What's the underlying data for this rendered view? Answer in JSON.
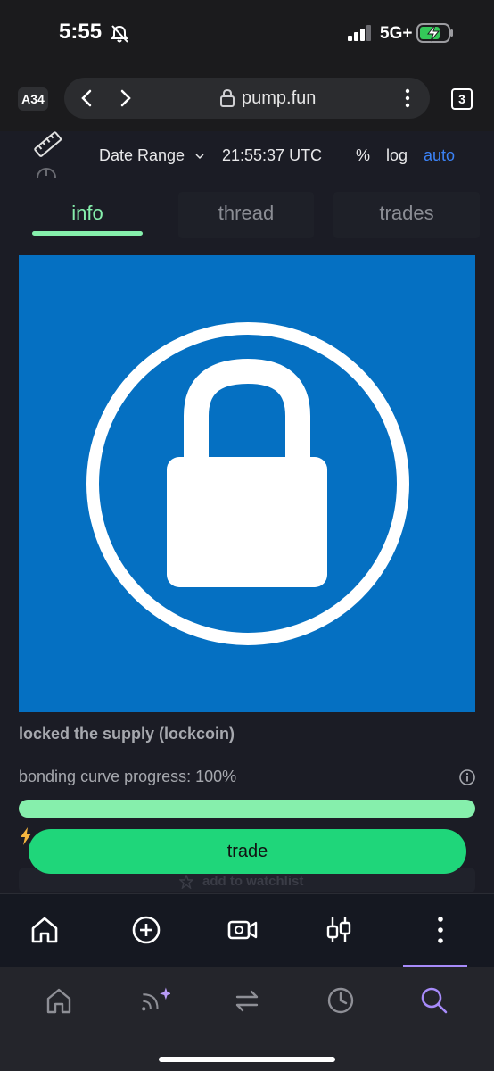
{
  "status_bar": {
    "time": "5:55",
    "network": "5G+"
  },
  "browser": {
    "profile_badge": "A34",
    "url": "pump.fun",
    "tab_count": "3"
  },
  "chart_toolbar": {
    "date_range": "Date Range",
    "utc_time": "21:55:37 UTC",
    "percent": "%",
    "log": "log",
    "auto": "auto"
  },
  "tabs": [
    {
      "label": "info",
      "active": true
    },
    {
      "label": "thread",
      "active": false
    },
    {
      "label": "trades",
      "active": false
    }
  ],
  "coin": {
    "name": "locked the supply (lockcoin)",
    "image_icon": "padlock-in-circle",
    "image_background": "#0570c2"
  },
  "bonding_curve": {
    "label": "bonding curve progress: 100%",
    "progress": 1.0
  },
  "watchlist": {
    "label": "add to watchlist"
  },
  "trade_button": {
    "label": "trade"
  },
  "app_nav": [
    {
      "icon": "home-icon"
    },
    {
      "icon": "plus-circle-icon"
    },
    {
      "icon": "video-icon"
    },
    {
      "icon": "candlestick-icon"
    },
    {
      "icon": "more-vertical-icon"
    }
  ],
  "browser_nav": [
    {
      "icon": "home-icon"
    },
    {
      "icon": "feed-sparkle-icon"
    },
    {
      "icon": "swap-icon"
    },
    {
      "icon": "history-icon"
    },
    {
      "icon": "search-icon",
      "active": true
    }
  ],
  "colors": {
    "accent_green": "#86efac",
    "trade_green": "#1fd67a",
    "auto_blue": "#3b82f6",
    "active_purple": "#a78bfa"
  }
}
